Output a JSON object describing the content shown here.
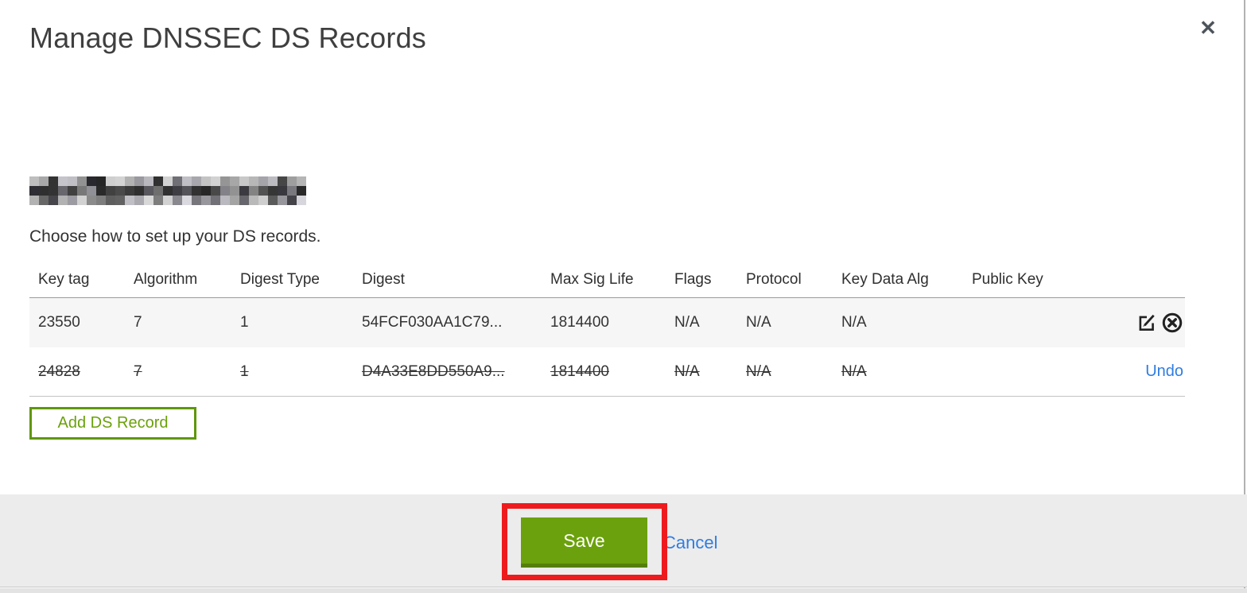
{
  "modal": {
    "title": "Manage DNSSEC DS Records",
    "close_icon": "✕",
    "instruction": "Choose how to set up your DS records.",
    "colors": {
      "accent_green": "#6ba10b",
      "green_dark": "#567f0a",
      "link_blue": "#2f7de1",
      "annotation_red": "#ee1b1e",
      "row_alt_bg": "#f6f6f6",
      "footer_bg": "#ececec"
    }
  },
  "table": {
    "headers": [
      "Key tag",
      "Algorithm",
      "Digest Type",
      "Digest",
      "Max Sig Life",
      "Flags",
      "Protocol",
      "Key Data Alg",
      "Public Key"
    ],
    "rows": [
      {
        "key_tag": "23550",
        "algorithm": "7",
        "digest_type": "1",
        "digest": "54FCF030AA1C79...",
        "max_sig_life": "1814400",
        "flags": "N/A",
        "protocol": "N/A",
        "key_data_alg": "N/A",
        "public_key": "",
        "deleted": false
      },
      {
        "key_tag": "24828",
        "algorithm": "7",
        "digest_type": "1",
        "digest": "D4A33E8DD550A9...",
        "max_sig_life": "1814400",
        "flags": "N/A",
        "protocol": "N/A",
        "key_data_alg": "N/A",
        "public_key": "",
        "deleted": true,
        "undo_label": "Undo"
      }
    ]
  },
  "buttons": {
    "add_ds_record": "Add DS Record",
    "save": "Save",
    "cancel": "Cancel"
  }
}
